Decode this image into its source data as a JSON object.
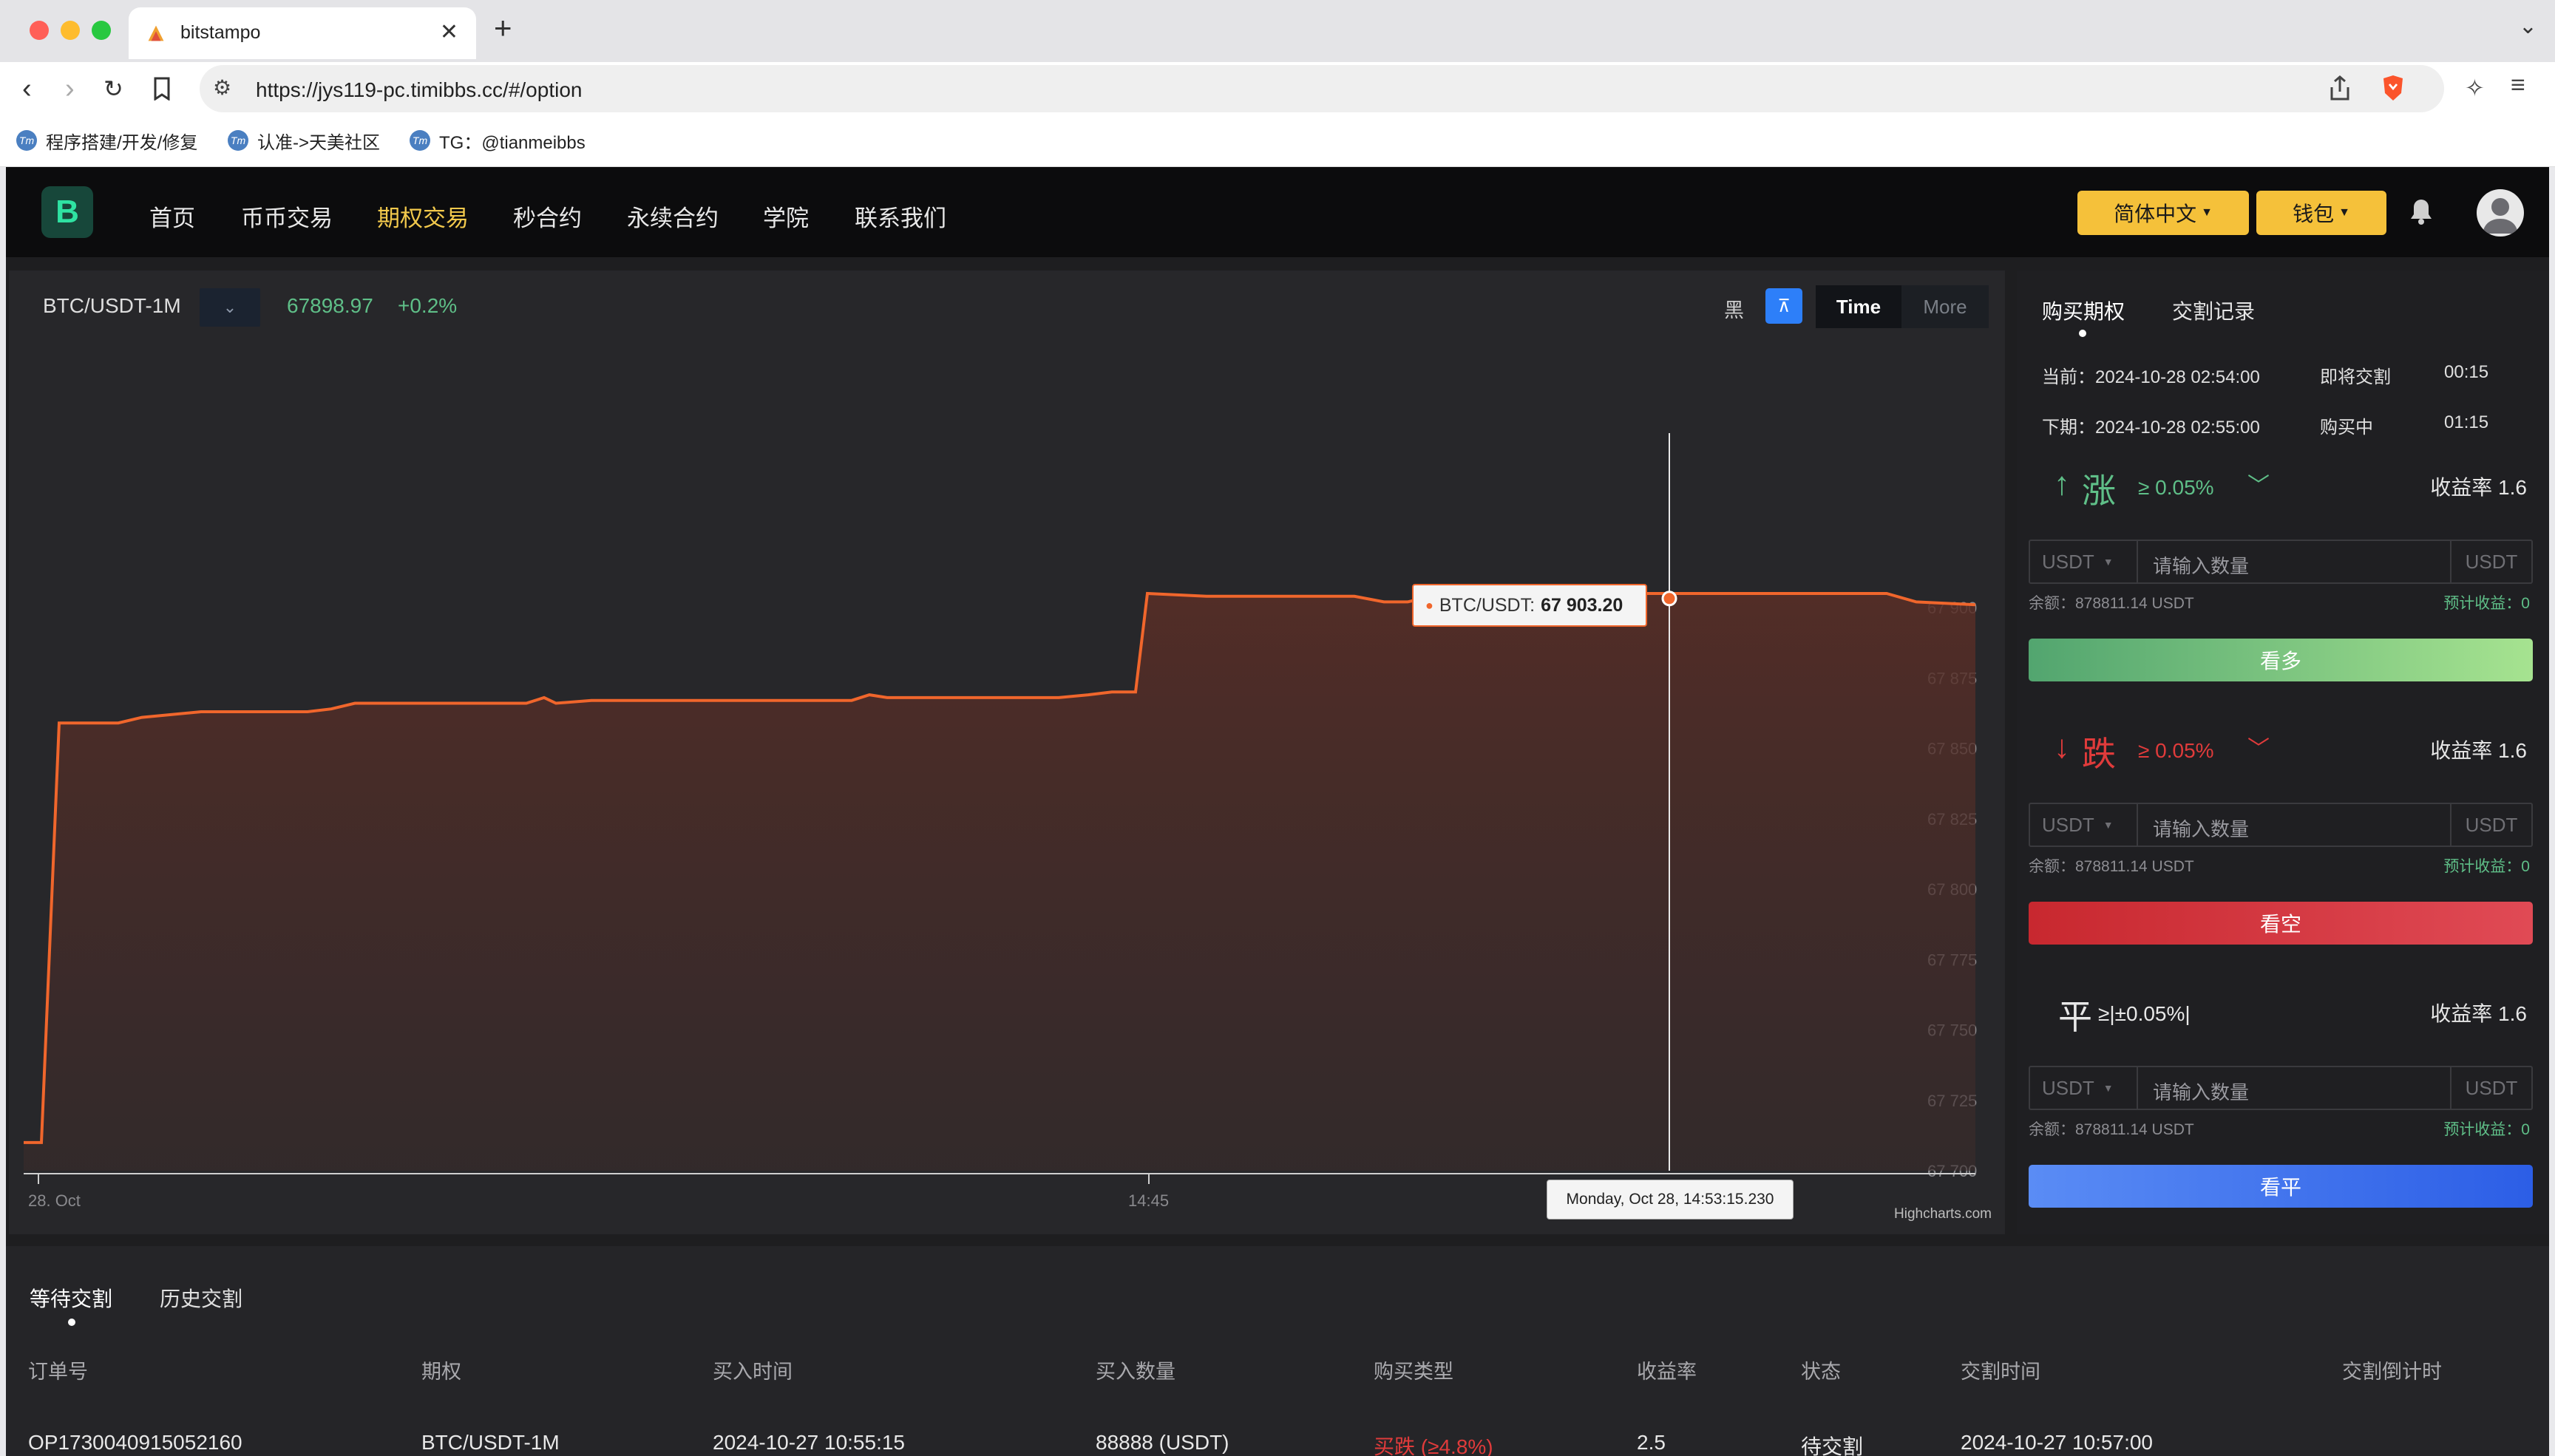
{
  "browser": {
    "tab_title": "bitstampo",
    "url": "https://jys119-pc.timibbs.cc/#/option",
    "bookmarks": [
      "程序搭建/开发/修复",
      "认准->天美社区",
      "TG：@tianmeibbs"
    ]
  },
  "app": {
    "logo": "B",
    "nav": [
      "首页",
      "币币交易",
      "期权交易",
      "秒合约",
      "永续合约",
      "学院",
      "联系我们"
    ],
    "active_nav": "期权交易",
    "language_btn": "简体中文",
    "wallet_btn": "钱包"
  },
  "chart": {
    "pair": "BTC/USDT-1M",
    "price": "67898.97",
    "change": "+0.2%",
    "theme_label": "黑",
    "seg_time": "Time",
    "seg_more": "More",
    "tooltip_label": "BTC/USDT:",
    "tooltip_value": "67 903.20",
    "xtip": "Monday, Oct 28, 14:53:15.230",
    "credit": "Highcharts.com",
    "x_labels": [
      "28. Oct",
      "14:45"
    ],
    "y_labels": [
      "67 900",
      "67 875",
      "67 850",
      "67 825",
      "67 800",
      "67 775",
      "67 750",
      "67 725",
      "67 700"
    ]
  },
  "chart_data": {
    "type": "area",
    "title": "BTC/USDT-1M",
    "xlabel": "",
    "ylabel": "",
    "ylim": [
      67700,
      67905
    ],
    "xlim": [
      "14:33",
      "14:54"
    ],
    "y_ticks": [
      67700,
      67725,
      67750,
      67775,
      67800,
      67825,
      67850,
      67875,
      67900
    ],
    "x_ticks": [
      "28. Oct",
      "14:45"
    ],
    "series": [
      {
        "points": [
          [
            0,
            67710
          ],
          [
            0.3,
            67710
          ],
          [
            0.6,
            67859
          ],
          [
            1.0,
            67859
          ],
          [
            1.6,
            67859
          ],
          [
            2.0,
            67861
          ],
          [
            3.0,
            67863
          ],
          [
            4.8,
            67863
          ],
          [
            5.2,
            67864
          ],
          [
            5.6,
            67866
          ],
          [
            8.5,
            67866
          ],
          [
            8.8,
            67868
          ],
          [
            9.0,
            67866
          ],
          [
            9.6,
            67867
          ],
          [
            14.0,
            67867
          ],
          [
            14.3,
            67869
          ],
          [
            14.6,
            67868
          ],
          [
            17.5,
            67868
          ],
          [
            18.0,
            67869
          ],
          [
            18.4,
            67870
          ],
          [
            18.8,
            67870
          ],
          [
            19.0,
            67905
          ],
          [
            20.0,
            67904
          ],
          [
            21.0,
            67904
          ],
          [
            22.5,
            67904
          ],
          [
            23.0,
            67902
          ],
          [
            23.4,
            67902
          ],
          [
            23.8,
            67904
          ],
          [
            24.0,
            67904
          ],
          [
            24.4,
            67906
          ],
          [
            26.0,
            67906
          ],
          [
            26.5,
            67905
          ],
          [
            31.5,
            67905
          ],
          [
            32.0,
            67902
          ],
          [
            33.0,
            67901
          ]
        ]
      }
    ],
    "grid": false,
    "legend": false
  },
  "panel": {
    "tabs": [
      "购买期权",
      "交割记录"
    ],
    "current_label": "当前：2024-10-28 02:54:00",
    "current_status": "即将交割",
    "current_countdown": "00:15",
    "next_label": "下期：2024-10-28 02:55:00",
    "next_status": "购买中",
    "next_countdown": "01:15",
    "up": {
      "arrow": "↑",
      "char": "涨",
      "pct": "≥ 0.05%",
      "yield": "收益率 1.6",
      "button": "看多"
    },
    "down": {
      "arrow": "↓",
      "char": "跌",
      "pct": "≥ 0.05%",
      "yield": "收益率 1.6",
      "button": "看空"
    },
    "flat": {
      "char": "平",
      "pct": "≥|±0.05%|",
      "yield": "收益率 1.6",
      "button": "看平"
    },
    "currency": "USDT",
    "placeholder": "请输入数量",
    "unit": "USDT",
    "balance": "余额：878811.14 USDT",
    "estimate": "预计收益：0"
  },
  "orders": {
    "tabs": [
      "等待交割",
      "历史交割"
    ],
    "headers": [
      "订单号",
      "期权",
      "买入时间",
      "买入数量",
      "购买类型",
      "收益率",
      "状态",
      "交割时间",
      "交割倒计时"
    ],
    "rows": [
      [
        "OP1730040915052160",
        "BTC/USDT-1M",
        "2024-10-27 10:55:15",
        "88888 (USDT)",
        "买跌 (≥4.8%)",
        "2.5",
        "待交割",
        "2024-10-27 10:57:00",
        ""
      ]
    ]
  },
  "colors": {
    "accent_yellow": "#f5c13a",
    "up_green": "#5fbf88",
    "down_red": "#e03b3b",
    "line_orange": "#f0662c",
    "flat_blue": "#3a6ff0"
  }
}
